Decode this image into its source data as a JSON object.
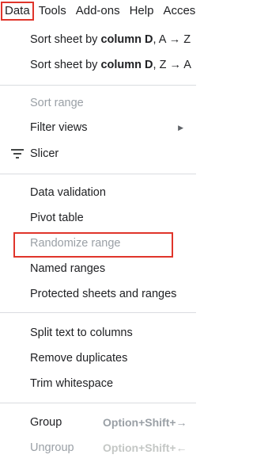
{
  "menubar": {
    "data": "Data",
    "tools": "Tools",
    "addons": "Add-ons",
    "help": "Help",
    "access": "Acces"
  },
  "menu": {
    "sort_az_prefix": "Sort sheet by ",
    "sort_az_bold": "column D",
    "sort_az_suffix": ", A → Z",
    "sort_za_prefix": "Sort sheet by ",
    "sort_za_bold": "column D",
    "sort_za_suffix": ", Z → A",
    "sort_range": "Sort range",
    "filter_views": "Filter views",
    "slicer": "Slicer",
    "data_validation": "Data validation",
    "pivot_table": "Pivot table",
    "randomize_range": "Randomize range",
    "named_ranges": "Named ranges",
    "protected_sheets": "Protected sheets and ranges",
    "split_text": "Split text to columns",
    "remove_duplicates": "Remove duplicates",
    "trim_whitespace": "Trim whitespace",
    "group": "Group",
    "group_shortcut": "Option+Shift+→",
    "ungroup": "Ungroup",
    "ungroup_shortcut": "Option+Shift+←"
  }
}
